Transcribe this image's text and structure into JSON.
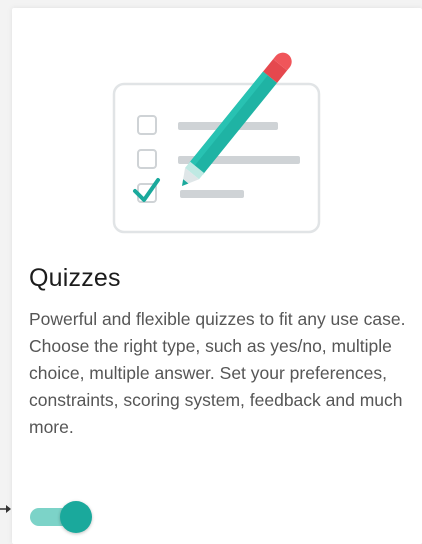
{
  "card": {
    "title": "Quizzes",
    "description": "Powerful and flexible quizzes to fit any use case. Choose the right type, such as yes/no, multiple choice, multiple answer. Set your preferences, constraints, scoring system, feedback and much more."
  },
  "toggle": {
    "state": "on"
  },
  "colors": {
    "accent": "#1aa99c",
    "accent_light": "#7cd3c8",
    "pencil_tip": "#f0555a",
    "line_gray": "#cfd3d6"
  },
  "icons": {
    "illustration": "quiz-checklist-pencil-icon",
    "pointer": "arrow-right-icon"
  }
}
